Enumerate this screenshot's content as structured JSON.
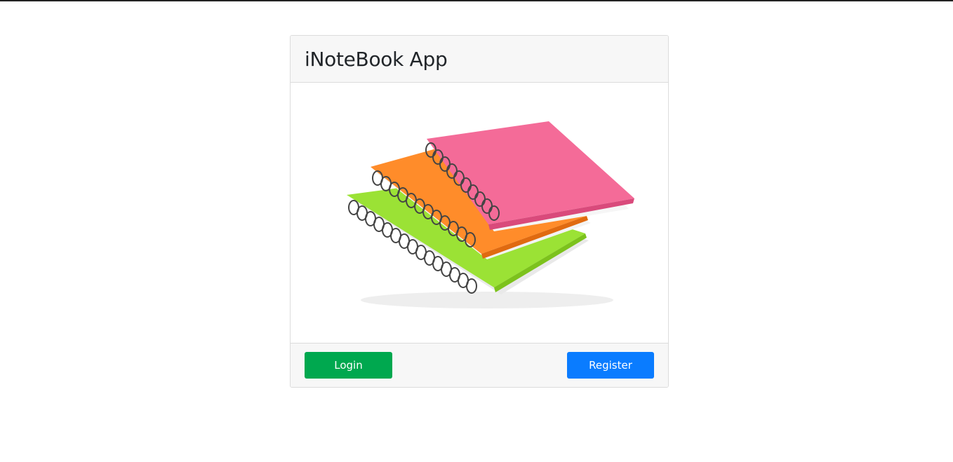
{
  "app": {
    "title": "iNoteBook App"
  },
  "image": {
    "subject": "notebooks-stack"
  },
  "actions": {
    "login_label": "Login",
    "register_label": "Register"
  },
  "colors": {
    "login": "#00a84f",
    "register": "#0a7cff",
    "notebook_pink": "#f46b98",
    "notebook_orange": "#ff8c2a",
    "notebook_green": "#9be235"
  }
}
